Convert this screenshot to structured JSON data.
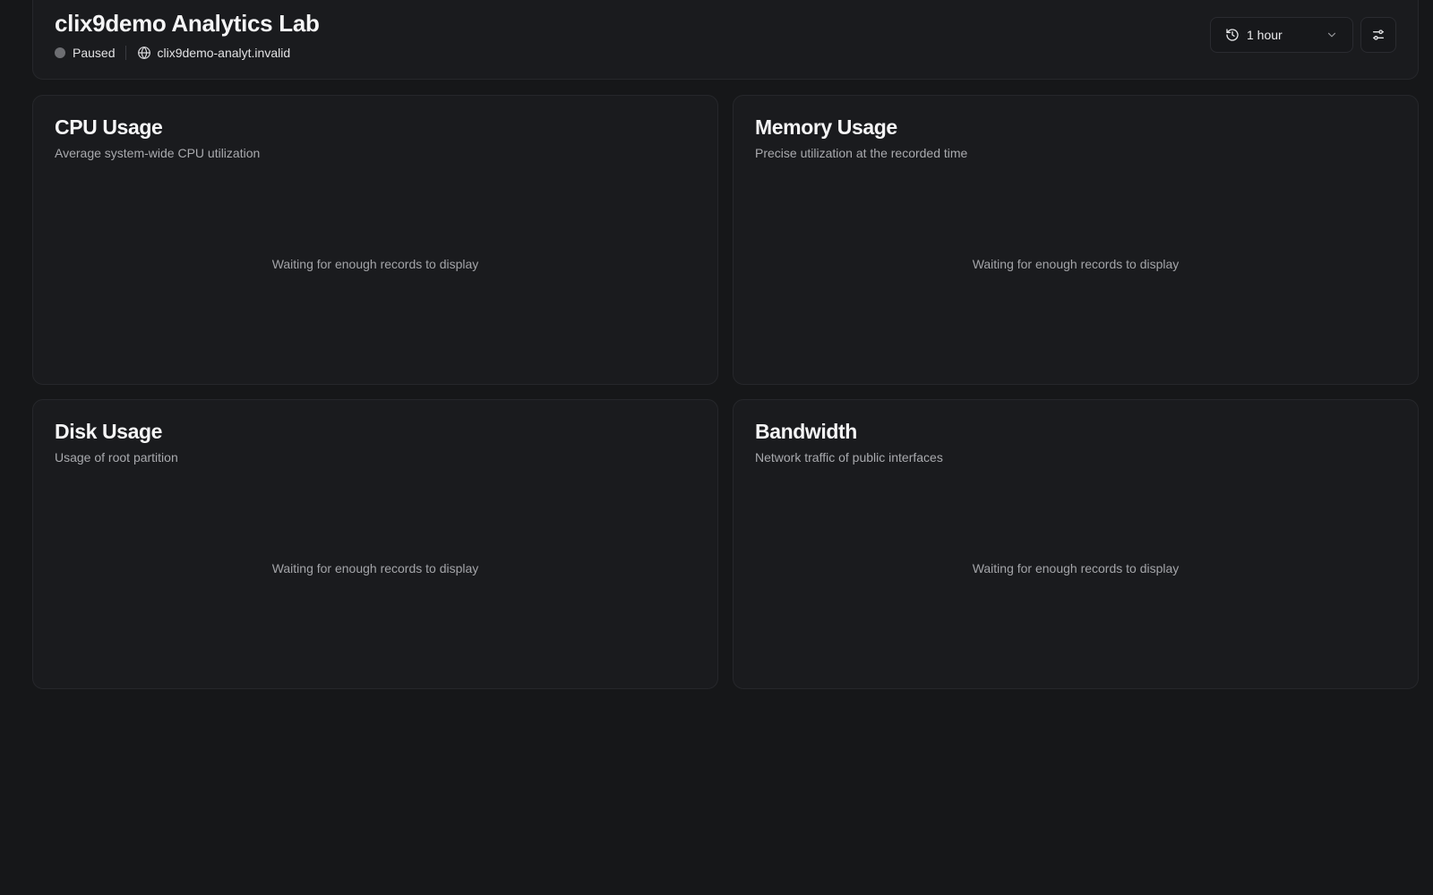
{
  "header": {
    "title": "clix9demo Analytics Lab",
    "status": "Paused",
    "status_color": "#6d6e72",
    "host": "clix9demo-analyt.invalid",
    "host_icon": "globe-icon",
    "time_range": {
      "selected": "1 hour",
      "icon": "history-icon",
      "toggle_icon": "chevron-down-icon"
    },
    "settings_icon": "sliders-icon"
  },
  "charts": [
    {
      "title": "CPU Usage",
      "description": "Average system-wide CPU utilization",
      "empty_message": "Waiting for enough records to display"
    },
    {
      "title": "Memory Usage",
      "description": "Precise utilization at the recorded time",
      "empty_message": "Waiting for enough records to display"
    },
    {
      "title": "Disk Usage",
      "description": "Usage of root partition",
      "empty_message": "Waiting for enough records to display"
    },
    {
      "title": "Bandwidth",
      "description": "Network traffic of public interfaces",
      "empty_message": "Waiting for enough records to display"
    }
  ],
  "theme": {
    "background": "#161719",
    "card_background": "#1a1b1e",
    "border": "#26272b"
  }
}
